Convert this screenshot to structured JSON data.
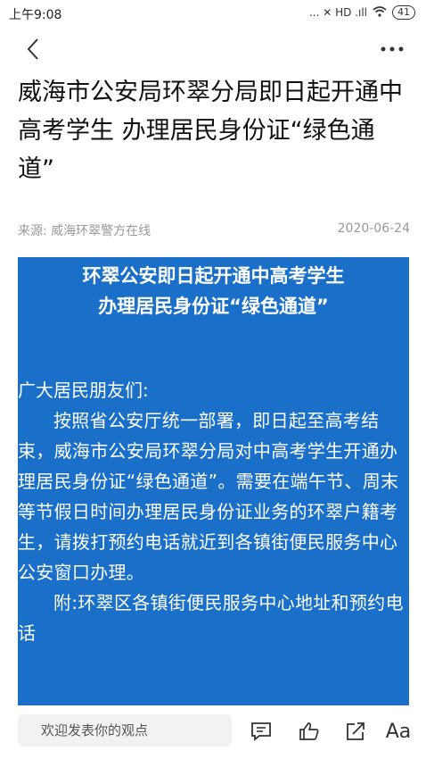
{
  "status_bar": {
    "time": "上午9:08",
    "indicators": "... ✕ HD .ıll",
    "battery": "41"
  },
  "nav": {
    "back_icon": "chevron-left-icon",
    "more_icon": "more-horizontal-icon"
  },
  "article": {
    "title": "威海市公安局环翠分局即日起开通中高考学生 办理居民身份证“绿色通道”",
    "source_label": "来源:",
    "source_name": "威海环翠警方在线",
    "date": "2020-06-24"
  },
  "card": {
    "background": "#1a6fc9",
    "title_line1": "环翠公安即日起开通中高考学生",
    "title_line2": "办理居民身份证“绿色通道”",
    "greeting": "广大居民朋友们:",
    "paragraph1": "按照省公安厅统一部署，即日起至高考结束，威海市公安局环翠分局对中高考学生开通办理居民身份证“绿色通道”。需要在端午节、周末等节假日时间办理居民身份证业务的环翠户籍考生，请拨打预约电话就近到各镇街便民服务中心公安窗口办理。",
    "paragraph2": "附:环翠区各镇街便民服务中心地址和预约电话"
  },
  "bottom_bar": {
    "comment_placeholder": "欢迎发表你的观点",
    "icons": [
      "comment-icon",
      "like-icon",
      "share-icon",
      "font-size-icon"
    ],
    "font_label": "Aa"
  }
}
